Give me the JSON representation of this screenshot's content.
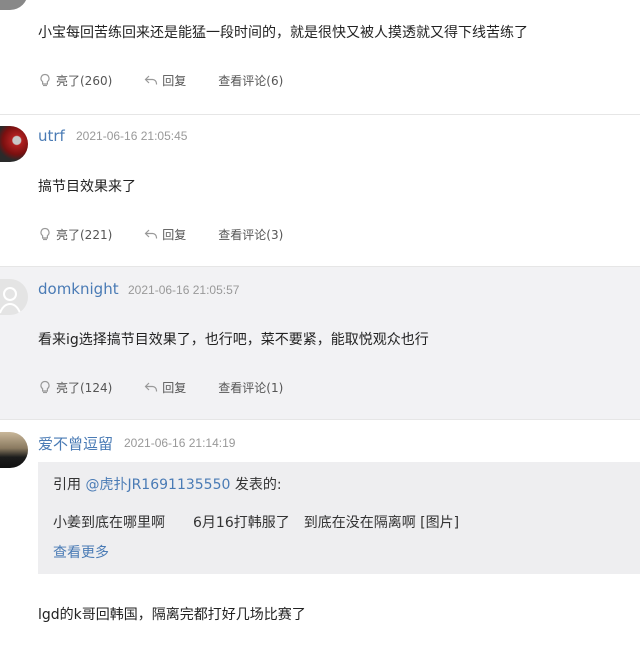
{
  "comments": [
    {
      "content": "小宝每回苦练回来还是能猛一段时间的，就是很快又被人摸透就又得下线苦练了",
      "actions": {
        "like": "亮了(260)",
        "reply": "回复",
        "view": "查看评论(6)"
      }
    },
    {
      "username": "utrf",
      "timestamp": "2021-06-16 21:05:45",
      "content": "搞节目效果来了",
      "actions": {
        "like": "亮了(221)",
        "reply": "回复",
        "view": "查看评论(3)"
      }
    },
    {
      "username": "domknight",
      "timestamp": "2021-06-16 21:05:57",
      "content": "看来ig选择搞节目效果了，也行吧，菜不要紧，能取悦观众也行",
      "actions": {
        "like": "亮了(124)",
        "reply": "回复",
        "view": "查看评论(1)"
      }
    },
    {
      "username": "爱不曾逗留",
      "timestamp": "2021-06-16 21:14:19",
      "quote": {
        "prefix": "引用",
        "user": "@虎扑JR1691135550",
        "suffix": "发表的:",
        "text": "小姜到底在哪里啊　　6月16打韩服了　到底在没在隔离啊 [图片]",
        "more": "查看更多"
      },
      "content": "lgd的k哥回韩国，隔离完都打好几场比赛了"
    }
  ],
  "colors": {
    "link": "#4a7bb5",
    "shaded_bg": "#f2f2f4",
    "quote_bg": "#eeeef0"
  }
}
